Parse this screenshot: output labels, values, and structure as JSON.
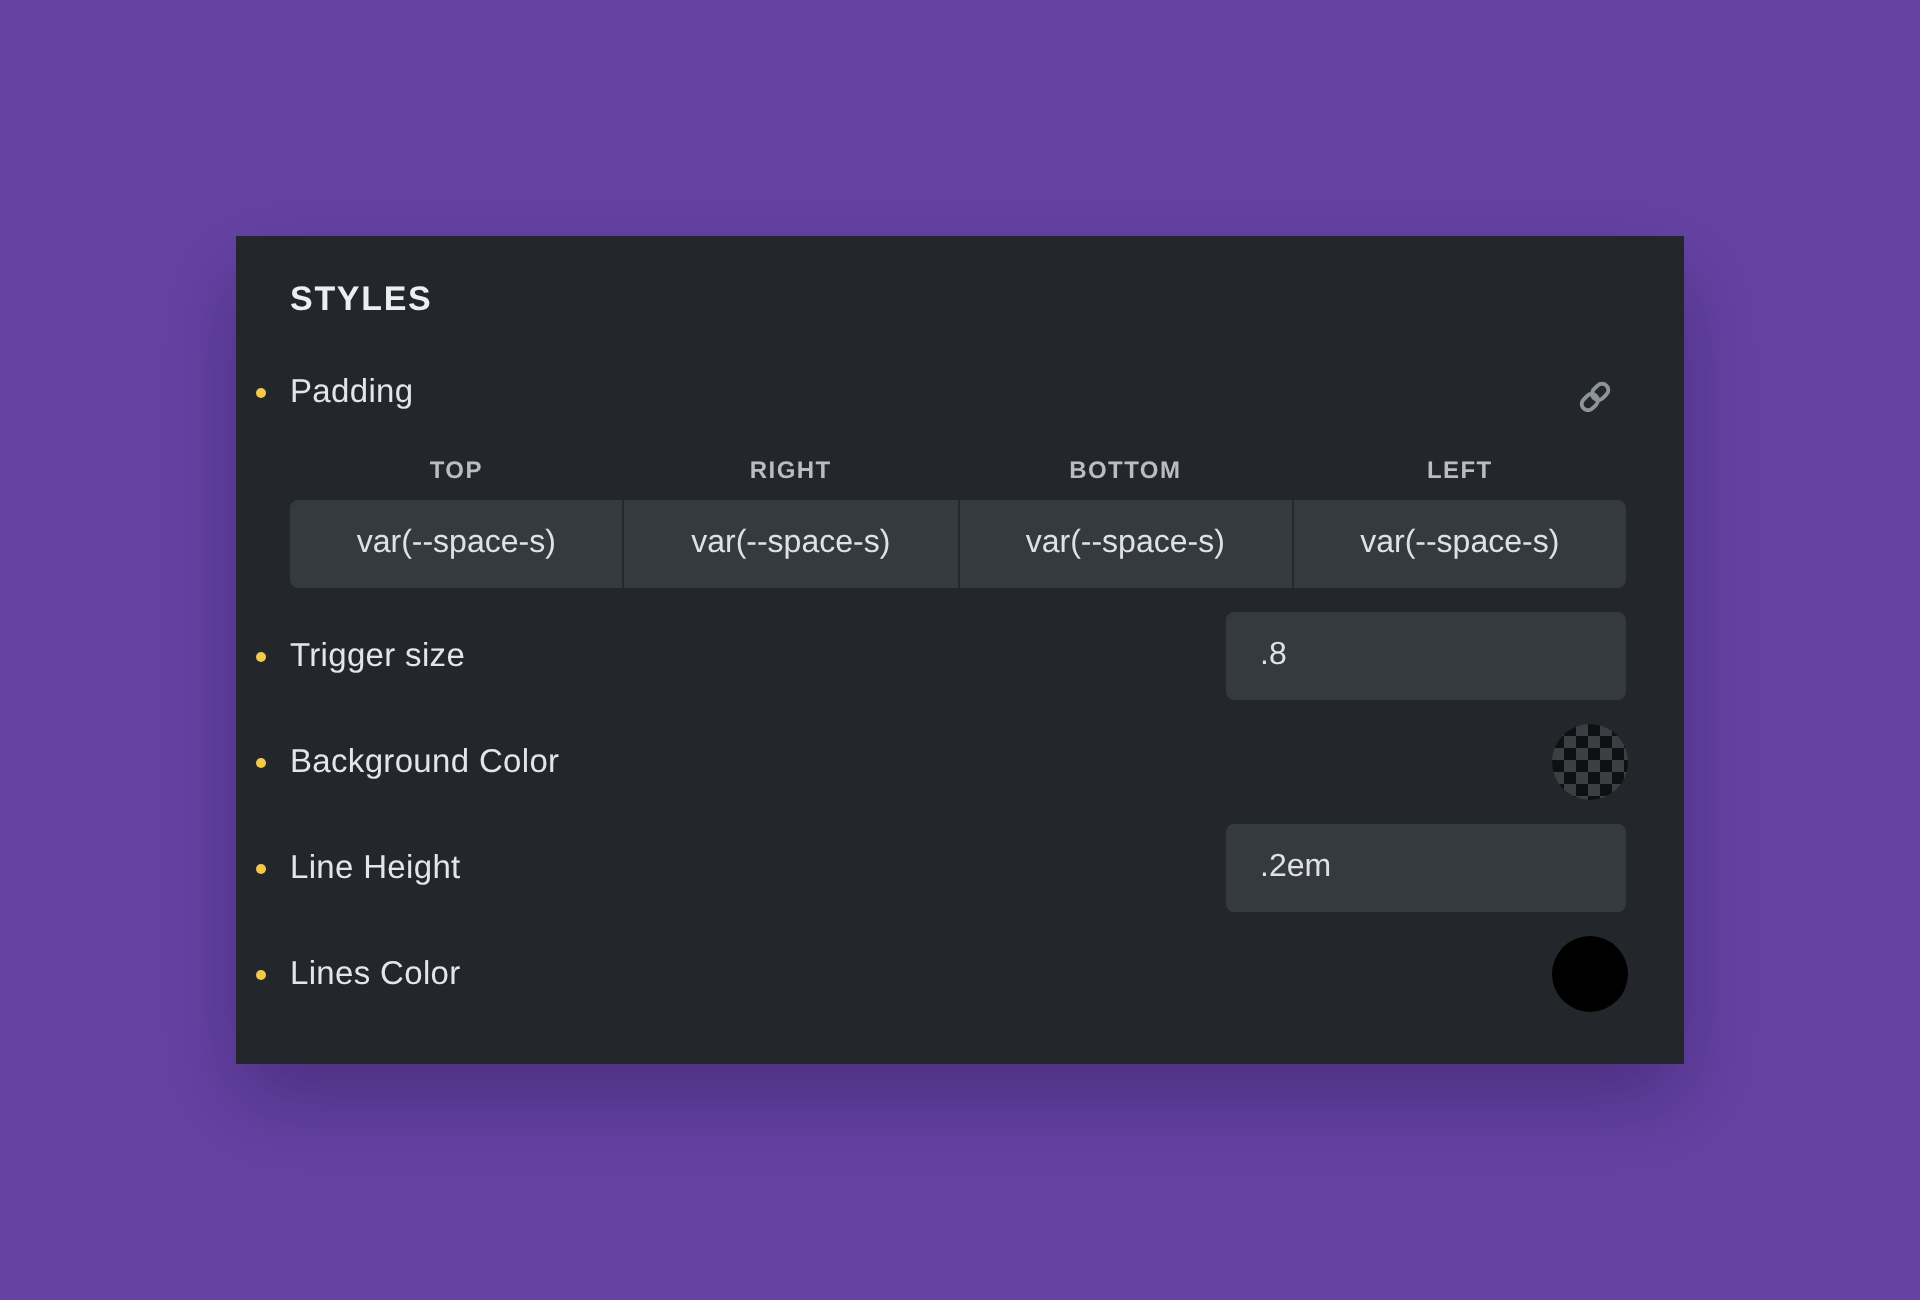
{
  "panel": {
    "title": "STYLES"
  },
  "controls": [
    {
      "kind": "spacing",
      "label": "Padding",
      "modified": true,
      "sides": [
        {
          "label": "TOP",
          "value": "var(--space-s)"
        },
        {
          "label": "RIGHT",
          "value": "var(--space-s)"
        },
        {
          "label": "BOTTOM",
          "value": "var(--space-s)"
        },
        {
          "label": "LEFT",
          "value": "var(--space-s)"
        }
      ]
    },
    {
      "kind": "text",
      "label": "Trigger size",
      "modified": true,
      "value": ".8"
    },
    {
      "kind": "color",
      "label": "Background Color",
      "modified": true
    },
    {
      "kind": "text",
      "label": "Line Height",
      "modified": true,
      "value": ".2em"
    },
    {
      "kind": "color",
      "label": "Lines Color",
      "modified": true,
      "color": "#000000"
    }
  ]
}
